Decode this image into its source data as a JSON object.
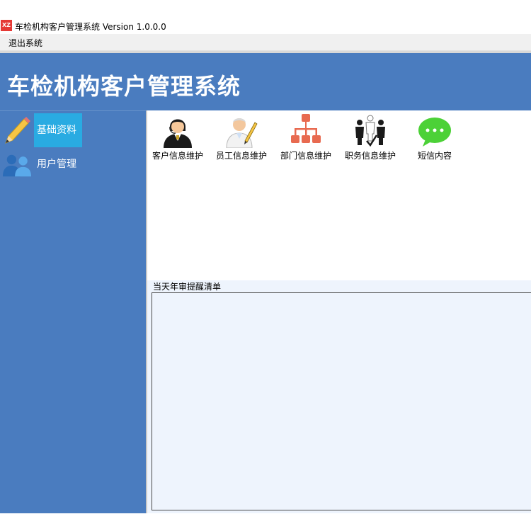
{
  "window": {
    "app_icon_text": "XZ",
    "title": "车检机构客户管理系统 Version 1.0.0.0"
  },
  "menu": {
    "items": [
      {
        "label": "退出系统"
      }
    ]
  },
  "banner": {
    "title": "车检机构客户管理系统"
  },
  "sidebar": {
    "items": [
      {
        "label": "基础资料",
        "icon": "pencil-icon",
        "active": true
      },
      {
        "label": "用户管理",
        "icon": "users-icon",
        "active": false
      }
    ]
  },
  "toolbar": {
    "items": [
      {
        "label": "客户信息维护",
        "icon": "customer-service-icon"
      },
      {
        "label": "员工信息维护",
        "icon": "employee-icon"
      },
      {
        "label": "部门信息维护",
        "icon": "org-chart-icon"
      },
      {
        "label": "职务信息维护",
        "icon": "job-position-icon"
      },
      {
        "label": "短信内容",
        "icon": "sms-bubble-icon"
      }
    ]
  },
  "reminder": {
    "title": "当天年审提醒清单"
  },
  "colors": {
    "banner": "#4a7cbf",
    "sidebar_active": "#29abe2",
    "reminder_bg": "#eef4fd"
  }
}
